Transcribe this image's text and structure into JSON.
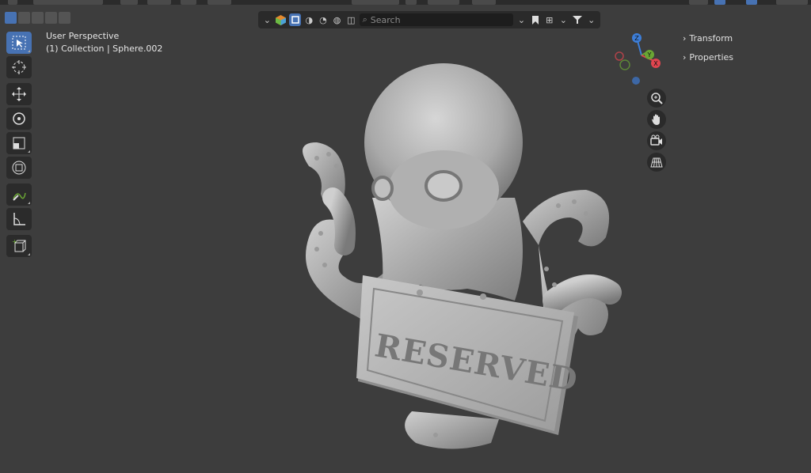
{
  "viewport": {
    "line1": "User Perspective",
    "line2": "(1) Collection | Sphere.002"
  },
  "header": {
    "search_placeholder": "Search"
  },
  "sidebar": {
    "transform_label": "Transform",
    "properties_label": "Properties"
  },
  "gizmo": {
    "z_label": "Z",
    "y_label": "Y",
    "x_label": "X"
  },
  "sign": {
    "text": "RESERVED"
  },
  "tools": [
    "select-box",
    "cursor",
    "move",
    "rotate",
    "scale",
    "transform",
    "annotate",
    "measure",
    "add-cube"
  ],
  "colors": {
    "accent": "#4772b3",
    "background": "#3d3d3d",
    "x_axis": "#e0454f",
    "y_axis": "#6aa534",
    "z_axis": "#3d7ed8"
  }
}
